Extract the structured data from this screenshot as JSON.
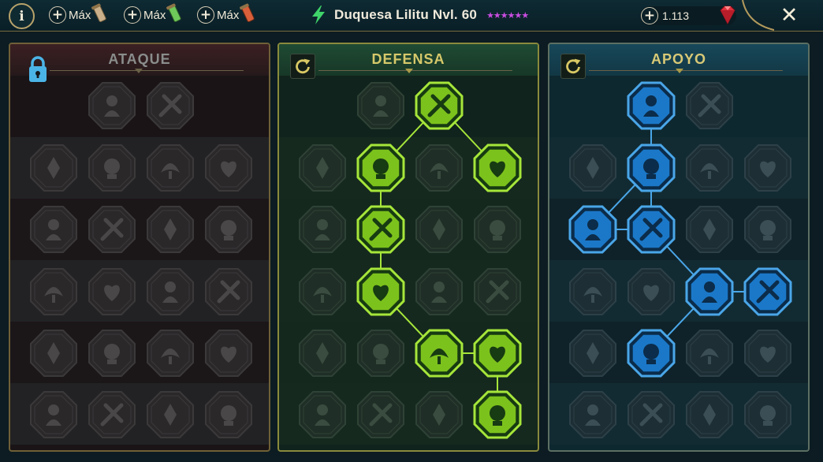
{
  "topbar": {
    "info_label": "i",
    "resources": [
      {
        "label": "Máx",
        "icon": "scroll-bronze-icon",
        "color": "#c9b08a"
      },
      {
        "label": "Máx",
        "icon": "scroll-green-icon",
        "color": "#6ec85a"
      },
      {
        "label": "Máx",
        "icon": "scroll-red-icon",
        "color": "#d9603a"
      }
    ],
    "champion_name": "Duquesa Lilitu Nvl. 60",
    "stars": "★★★★★★",
    "gems": "1.113",
    "close_label": "✕"
  },
  "panels": [
    {
      "id": "attack",
      "title": "ATAQUE",
      "control": "lock-icon",
      "accent": "#4bb4e6",
      "nodes": [
        {
          "col": 1,
          "row": 0,
          "icon": "sword-cross-icon",
          "state": "locked"
        },
        {
          "col": 2,
          "row": 0,
          "icon": "triple-claw-icon",
          "state": "locked"
        },
        {
          "col": 0,
          "row": 1,
          "icon": "figure-heart-icon",
          "state": "locked"
        },
        {
          "col": 1,
          "row": 1,
          "icon": "rays-fan-icon",
          "state": "locked"
        },
        {
          "col": 2,
          "row": 1,
          "icon": "dragon-head-icon",
          "state": "locked"
        },
        {
          "col": 3,
          "row": 1,
          "icon": "pierced-heart-icon",
          "state": "locked"
        },
        {
          "col": 0,
          "row": 2,
          "icon": "thrower-figure-icon",
          "state": "locked"
        },
        {
          "col": 1,
          "row": 2,
          "icon": "fanged-mouth-icon",
          "state": "locked"
        },
        {
          "col": 2,
          "row": 2,
          "icon": "skull-swoosh-icon",
          "state": "locked"
        },
        {
          "col": 3,
          "row": 2,
          "icon": "claw-slash-icon",
          "state": "locked"
        },
        {
          "col": 0,
          "row": 3,
          "icon": "heart-dagger-icon",
          "state": "locked"
        },
        {
          "col": 1,
          "row": 3,
          "icon": "sword-hand-icon",
          "state": "locked"
        },
        {
          "col": 2,
          "row": 3,
          "icon": "axe-icon",
          "state": "locked"
        },
        {
          "col": 3,
          "row": 3,
          "icon": "chain-bolt-icon",
          "state": "locked"
        },
        {
          "col": 0,
          "row": 4,
          "icon": "horned-mask-icon",
          "state": "locked"
        },
        {
          "col": 1,
          "row": 4,
          "icon": "skull-icon",
          "state": "locked"
        },
        {
          "col": 2,
          "row": 4,
          "icon": "target-rune-icon",
          "state": "locked"
        },
        {
          "col": 3,
          "row": 4,
          "icon": "totem-icon",
          "state": "locked"
        },
        {
          "col": 0,
          "row": 5,
          "icon": "fire-sword-icon",
          "state": "locked"
        },
        {
          "col": 1,
          "row": 5,
          "icon": "knight-helm-icon",
          "state": "locked"
        },
        {
          "col": 2,
          "row": 5,
          "icon": "winged-demon-icon",
          "state": "locked"
        },
        {
          "col": 3,
          "row": 5,
          "icon": "crowned-skull-icon",
          "state": "locked"
        }
      ],
      "links": []
    },
    {
      "id": "defense",
      "title": "DEFENSA",
      "control": "reset-icon",
      "accent": "#a6e63a",
      "nodes": [
        {
          "col": 1,
          "row": 0,
          "icon": "cracked-shield-icon",
          "state": "locked"
        },
        {
          "col": 2,
          "row": 0,
          "icon": "raised-fist-icon",
          "state": "active"
        },
        {
          "col": 0,
          "row": 1,
          "icon": "chevron-armor-icon",
          "state": "locked"
        },
        {
          "col": 1,
          "row": 1,
          "icon": "anatomical-heart-icon",
          "state": "active"
        },
        {
          "col": 2,
          "row": 1,
          "icon": "demon-figure-icon",
          "state": "locked"
        },
        {
          "col": 3,
          "row": 1,
          "icon": "crossed-blades-icon",
          "state": "active"
        },
        {
          "col": 0,
          "row": 2,
          "icon": "caped-figure-icon",
          "state": "locked"
        },
        {
          "col": 1,
          "row": 2,
          "icon": "knight-shield-icon",
          "state": "active"
        },
        {
          "col": 2,
          "row": 2,
          "icon": "gem-shield-icon",
          "state": "locked"
        },
        {
          "col": 3,
          "row": 2,
          "icon": "hooded-face-icon",
          "state": "locked"
        },
        {
          "col": 0,
          "row": 3,
          "icon": "warrior-pair-icon",
          "state": "locked"
        },
        {
          "col": 1,
          "row": 3,
          "icon": "hourglass-skull-icon",
          "state": "active"
        },
        {
          "col": 2,
          "row": 3,
          "icon": "open-hand-icon",
          "state": "locked"
        },
        {
          "col": 3,
          "row": 3,
          "icon": "horned-beast-icon",
          "state": "locked"
        },
        {
          "col": 0,
          "row": 4,
          "icon": "running-figure-icon",
          "state": "locked"
        },
        {
          "col": 1,
          "row": 4,
          "icon": "flame-drops-icon",
          "state": "locked"
        },
        {
          "col": 2,
          "row": 4,
          "icon": "sun-skull-icon",
          "state": "active"
        },
        {
          "col": 3,
          "row": 4,
          "icon": "hand-swirl-icon",
          "state": "active"
        },
        {
          "col": 0,
          "row": 5,
          "icon": "ghoul-face-icon",
          "state": "locked"
        },
        {
          "col": 1,
          "row": 5,
          "icon": "twin-claws-icon",
          "state": "locked"
        },
        {
          "col": 2,
          "row": 5,
          "icon": "plague-figure-icon",
          "state": "locked"
        },
        {
          "col": 3,
          "row": 5,
          "icon": "strongman-icon",
          "state": "active"
        }
      ],
      "links": [
        [
          2,
          0,
          1,
          1
        ],
        [
          2,
          0,
          3,
          1
        ],
        [
          1,
          1,
          1,
          2
        ],
        [
          1,
          2,
          1,
          3
        ],
        [
          1,
          3,
          2,
          4
        ],
        [
          2,
          4,
          3,
          4
        ],
        [
          3,
          4,
          3,
          5
        ]
      ]
    },
    {
      "id": "support",
      "title": "APOYO",
      "control": "reset-icon",
      "accent": "#4aa6e8",
      "nodes": [
        {
          "col": 1,
          "row": 0,
          "icon": "heart-plus-icon",
          "state": "active"
        },
        {
          "col": 2,
          "row": 0,
          "icon": "bleeding-swirl-icon",
          "state": "locked"
        },
        {
          "col": 0,
          "row": 1,
          "icon": "praying-hands-icon",
          "state": "locked"
        },
        {
          "col": 1,
          "row": 1,
          "icon": "layered-shield-icon",
          "state": "active"
        },
        {
          "col": 2,
          "row": 1,
          "icon": "skull-flame-icon",
          "state": "locked"
        },
        {
          "col": 3,
          "row": 1,
          "icon": "speed-boot-icon",
          "state": "locked"
        },
        {
          "col": 0,
          "row": 2,
          "icon": "blessed-figure-icon",
          "state": "active"
        },
        {
          "col": 1,
          "row": 2,
          "icon": "lightning-shield-icon",
          "state": "active"
        },
        {
          "col": 2,
          "row": 2,
          "icon": "coiled-snake-icon",
          "state": "locked"
        },
        {
          "col": 3,
          "row": 2,
          "icon": "warrior-silhouette-icon",
          "state": "locked"
        },
        {
          "col": 0,
          "row": 3,
          "icon": "chained-heart-icon",
          "state": "locked"
        },
        {
          "col": 1,
          "row": 3,
          "icon": "fire-orb-icon",
          "state": "locked"
        },
        {
          "col": 2,
          "row": 3,
          "icon": "open-book-icon",
          "state": "active"
        },
        {
          "col": 3,
          "row": 3,
          "icon": "angry-eyes-icon",
          "state": "active"
        },
        {
          "col": 0,
          "row": 4,
          "icon": "compass-star-icon",
          "state": "locked"
        },
        {
          "col": 1,
          "row": 4,
          "icon": "winged-boot-icon",
          "state": "active"
        },
        {
          "col": 2,
          "row": 4,
          "icon": "all-seeing-eye-icon",
          "state": "locked"
        },
        {
          "col": 3,
          "row": 4,
          "icon": "dancing-figure-icon",
          "state": "locked"
        },
        {
          "col": 0,
          "row": 5,
          "icon": "bomb-skull-icon",
          "state": "locked"
        },
        {
          "col": 1,
          "row": 5,
          "icon": "skull-pile-icon",
          "state": "locked"
        },
        {
          "col": 2,
          "row": 5,
          "icon": "fist-punch-icon",
          "state": "locked"
        },
        {
          "col": 3,
          "row": 5,
          "icon": "eagle-head-icon",
          "state": "locked"
        }
      ],
      "links": [
        [
          1,
          0,
          1,
          1
        ],
        [
          1,
          1,
          0,
          2
        ],
        [
          1,
          1,
          1,
          2
        ],
        [
          0,
          2,
          1,
          2
        ],
        [
          1,
          2,
          2,
          3
        ],
        [
          2,
          3,
          3,
          3
        ],
        [
          2,
          3,
          1,
          4
        ]
      ]
    }
  ]
}
